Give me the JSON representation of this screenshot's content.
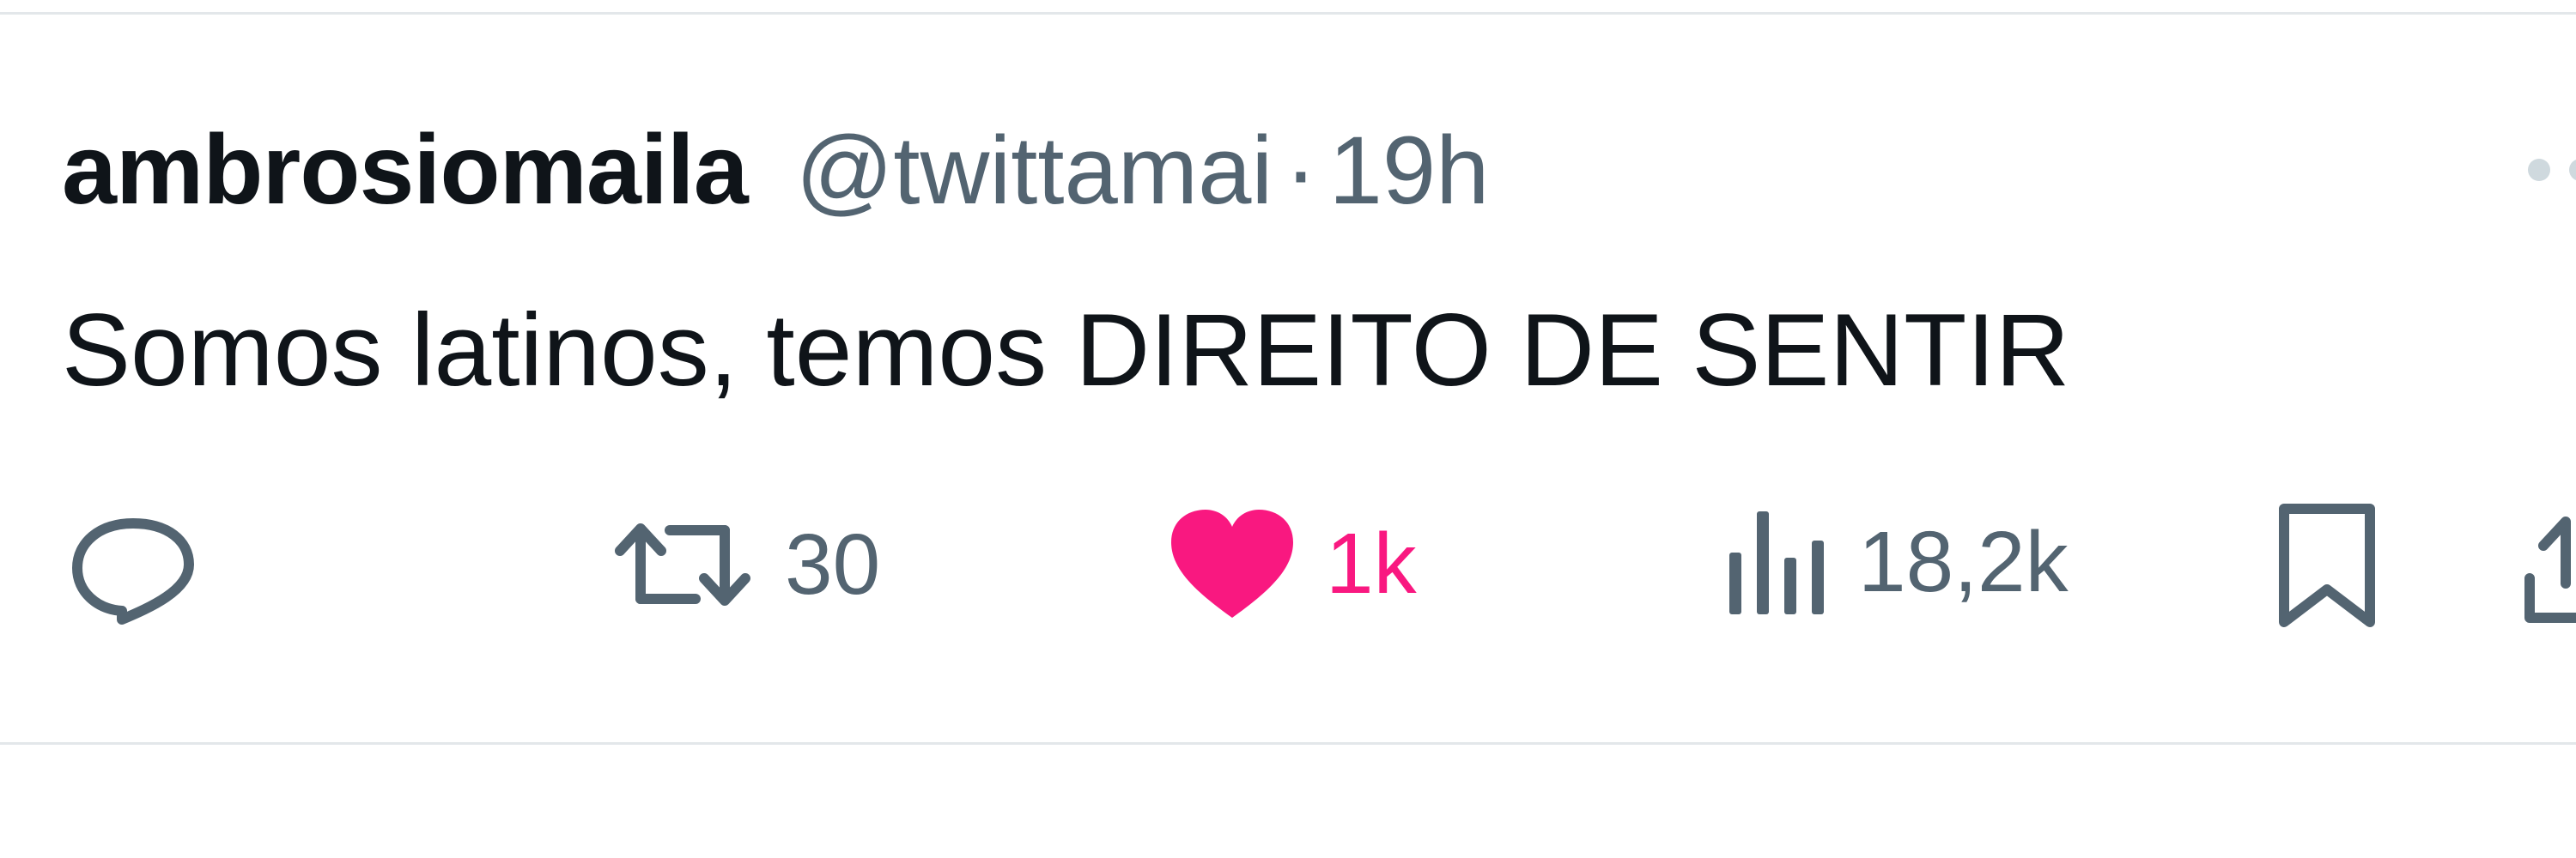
{
  "tweet": {
    "display_name": "ambrosiomaila",
    "handle": "@twittamai",
    "separator": "·",
    "time": "19h",
    "text": "Somos latinos, temos DIREITO DE SENTIR"
  },
  "actions": {
    "reply": {
      "icon": "reply-icon",
      "count": ""
    },
    "retweet": {
      "icon": "retweet-icon",
      "count": "30"
    },
    "like": {
      "icon": "heart-filled-icon",
      "count": "1k",
      "active": true,
      "color": "#f91880"
    },
    "views": {
      "icon": "views-chart-icon",
      "count": "18,2k"
    },
    "bookmark": {
      "icon": "bookmark-icon"
    },
    "share": {
      "icon": "share-icon"
    }
  },
  "colors": {
    "text_primary": "#0f1419",
    "text_secondary": "#536471",
    "like_active": "#f91880",
    "divider": "#e3e7ea"
  }
}
